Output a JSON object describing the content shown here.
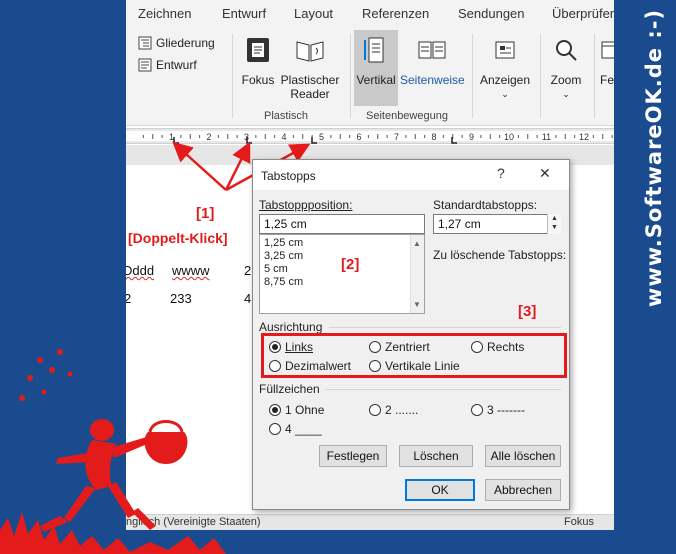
{
  "ribbon_tabs": [
    "Zeichnen",
    "Entwurf",
    "Layout",
    "Referenzen",
    "Sendungen",
    "Überprüfen"
  ],
  "ribbon": {
    "gliederung": "Gliederung",
    "entwurf": "Entwurf",
    "fokus": "Fokus",
    "plastischer_reader": "Plastischer Reader",
    "vertikal": "Vertikal",
    "seitenweise": "Seitenweise",
    "anzeigen": "Anzeigen",
    "zoom": "Zoom",
    "cut_label": "Fe",
    "group_plastisch": "Plastisch",
    "group_seitenbewegung": "Seitenbewegung"
  },
  "ruler_numbers": [
    "1",
    "2",
    "3",
    "4",
    "5",
    "6",
    "7",
    "8",
    "9",
    "10",
    "11",
    "12"
  ],
  "document": {
    "row1": [
      "Dddd",
      "wwww",
      "2"
    ],
    "row2": [
      "2",
      "233",
      "4"
    ]
  },
  "statusbar": {
    "language": "nglisch (Vereinigte Staaten)",
    "focus": "Fokus"
  },
  "annotations": {
    "a1": "[1]",
    "a1_sub": "[Doppelt-Klick]",
    "a2": "[2]",
    "a3": "[3]",
    "color": "#e41b1b"
  },
  "brand": "www.SoftwareOK.de :-)",
  "dialog": {
    "title": "Tabstopps",
    "help": "?",
    "close": "✕",
    "tab_position_label": "Tabstoppposition:",
    "tab_position_value": "1,25 cm",
    "tab_list": [
      "1,25 cm",
      "3,25 cm",
      "5 cm",
      "8,75 cm"
    ],
    "default_tabs_label": "Standardtabstopps:",
    "default_tabs_value": "1,27 cm",
    "to_delete_label": "Zu löschende Tabstopps:",
    "alignment_label": "Ausrichtung",
    "alignment": {
      "links": "Links",
      "zentriert": "Zentriert",
      "rechts": "Rechts",
      "dezimalwert": "Dezimalwert",
      "vertikale_linie": "Vertikale Linie"
    },
    "leader_label": "Füllzeichen",
    "leader": {
      "ohne": "1 Ohne",
      "dots": "2 .......",
      "dashes": "3 -------",
      "underline": "4 ____"
    },
    "buttons": {
      "festlegen": "Festlegen",
      "loeschen": "Löschen",
      "alle_loeschen": "Alle löschen",
      "ok": "OK",
      "abbrechen": "Abbrechen"
    }
  },
  "colors": {
    "frame": "#1a4b8f",
    "accent": "#0078d7",
    "annotation": "#e41b1b"
  }
}
